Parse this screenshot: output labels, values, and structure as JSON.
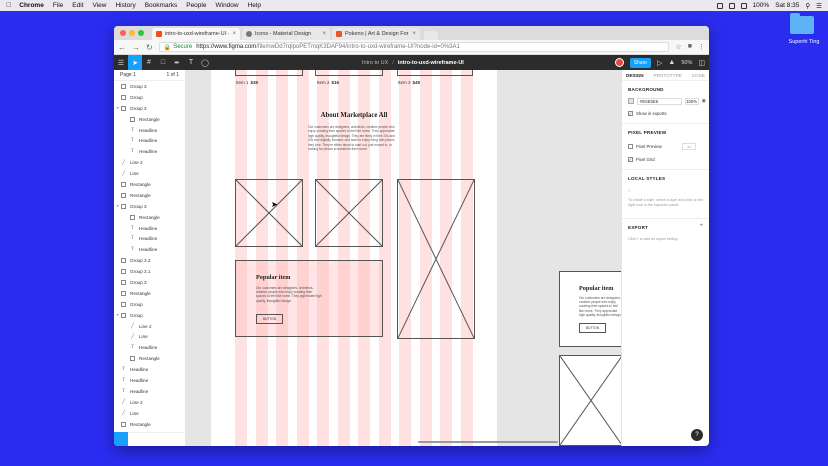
{
  "menubar": {
    "app": "Chrome",
    "items": [
      "File",
      "Edit",
      "View",
      "History",
      "Bookmarks",
      "People",
      "Window",
      "Help"
    ],
    "battery": "100%",
    "day": "Sat 8:35"
  },
  "desktop": {
    "folder_label": "Superhi Ting"
  },
  "browser": {
    "tabs": [
      {
        "label": "intro-to-uxd-wireframe-UI – F",
        "favicon_color": "#f24e1e"
      },
      {
        "label": "Icons - Material Design",
        "favicon_color": "#777777"
      },
      {
        "label": "Pokeno | Art & Design For You",
        "favicon_color": "#e8552e"
      }
    ],
    "secure_label": "Secure",
    "url_domain": "https://www.figma.com",
    "url_path": "/file/nwDd7rqlpoPETmqK3DAF94/intro-to-uxd-wireframe-UI?node-id=0%3A1"
  },
  "figma": {
    "project": "Intro to UX",
    "file": "intro-to-uxd-wireframe-UI",
    "share_label": "Share",
    "zoom": "50%",
    "page": "Page 1",
    "page_count": "1 of 1",
    "layers": [
      {
        "label": "Group 3",
        "icon": "frame",
        "indent": 0
      },
      {
        "label": "Group",
        "icon": "frame",
        "indent": 0
      },
      {
        "label": "Group 2",
        "icon": "frame",
        "indent": 0,
        "expanded": true
      },
      {
        "label": "Rectangle",
        "icon": "rect",
        "indent": 1
      },
      {
        "label": "Headline",
        "icon": "text",
        "indent": 1
      },
      {
        "label": "Headline",
        "icon": "text",
        "indent": 1
      },
      {
        "label": "Headline",
        "icon": "text",
        "indent": 1
      },
      {
        "label": "Line 2",
        "icon": "line",
        "indent": 0
      },
      {
        "label": "Line",
        "icon": "line",
        "indent": 0
      },
      {
        "label": "Rectangle",
        "icon": "rect",
        "indent": 0
      },
      {
        "label": "Rectangle",
        "icon": "rect",
        "indent": 0
      },
      {
        "label": "Group 3",
        "icon": "frame",
        "indent": 0,
        "expanded": true
      },
      {
        "label": "Rectangle",
        "icon": "rect",
        "indent": 1
      },
      {
        "label": "Headline",
        "icon": "text",
        "indent": 1
      },
      {
        "label": "Headline",
        "icon": "text",
        "indent": 1
      },
      {
        "label": "Headline",
        "icon": "text",
        "indent": 1
      },
      {
        "label": "Group 3.2",
        "icon": "frame",
        "indent": 0
      },
      {
        "label": "Group 3.1",
        "icon": "frame",
        "indent": 0
      },
      {
        "label": "Group 3",
        "icon": "frame",
        "indent": 0
      },
      {
        "label": "Rectangle",
        "icon": "rect",
        "indent": 0
      },
      {
        "label": "Group",
        "icon": "frame",
        "indent": 0
      },
      {
        "label": "Group",
        "icon": "frame",
        "indent": 0,
        "expanded": true
      },
      {
        "label": "Line 2",
        "icon": "line",
        "indent": 1
      },
      {
        "label": "Line",
        "icon": "line",
        "indent": 1
      },
      {
        "label": "Headline",
        "icon": "text",
        "indent": 1
      },
      {
        "label": "Rectangle",
        "icon": "rect",
        "indent": 1
      },
      {
        "label": "Headline",
        "icon": "text",
        "indent": 0
      },
      {
        "label": "Headline",
        "icon": "text",
        "indent": 0
      },
      {
        "label": "Headline",
        "icon": "text",
        "indent": 0
      },
      {
        "label": "Line 2",
        "icon": "line",
        "indent": 0
      },
      {
        "label": "Line",
        "icon": "line",
        "indent": 0
      },
      {
        "label": "Rectangle",
        "icon": "rect",
        "indent": 0
      }
    ],
    "canvas": {
      "prices": [
        {
          "name": "Item 1",
          "price": "$35"
        },
        {
          "name": "Item 2",
          "price": "$16"
        },
        {
          "name": "Item 3",
          "price": "$49"
        }
      ],
      "about_title": "About Marketplace All",
      "about_body": "Our customers are designers, architects, creative people who enjoy curating their spaces to feel like home. They appreciate high quality, thoughtful design. They are likely in their 20s and 30s and digitally focused, and want to enjoy living with pieces they love. They're either about to start out, just moved in, or looking for pieces to transform their home.",
      "popular_title": "Popular item",
      "popular_body": "Our customers are designers, architects, creative people who enjoy curating their spaces to feel like home. They appreciate high quality, thoughtful design.",
      "button_label": "BUTTON",
      "side_title": "Popular item",
      "side_body": "Our customers are designers, creative people who enjoy curating their spaces to feel like home. They appreciate high quality, thoughtful design.",
      "side_button": "BUTTON"
    },
    "props": {
      "tabs": [
        "DESIGN",
        "PROTOTYPE",
        "CODE"
      ],
      "background_label": "BACKGROUND",
      "bg_hex": "#E5E5E5",
      "bg_opacity": "100%",
      "show_in_exports": "Show in exports",
      "pixel_preview_label": "PIXEL PREVIEW",
      "pixel_preview": "Pixel Preview",
      "pixel_preview_value": "1x",
      "pixel_grid": "Pixel Grid",
      "local_styles_label": "LOCAL STYLES",
      "local_styles_hint": "To create a style, select a layer and click on the style icon in the inspector panel.",
      "export_label": "EXPORT",
      "export_hint": "Click + to add an export setting"
    }
  },
  "colors": {
    "figma_blue": "#18a0fb",
    "toolbar_dark": "#2c2c2c",
    "desktop_blue": "#2a2df0",
    "canvas_bg": "#e5e5e5",
    "grid_pink": "#ffb4b4"
  }
}
